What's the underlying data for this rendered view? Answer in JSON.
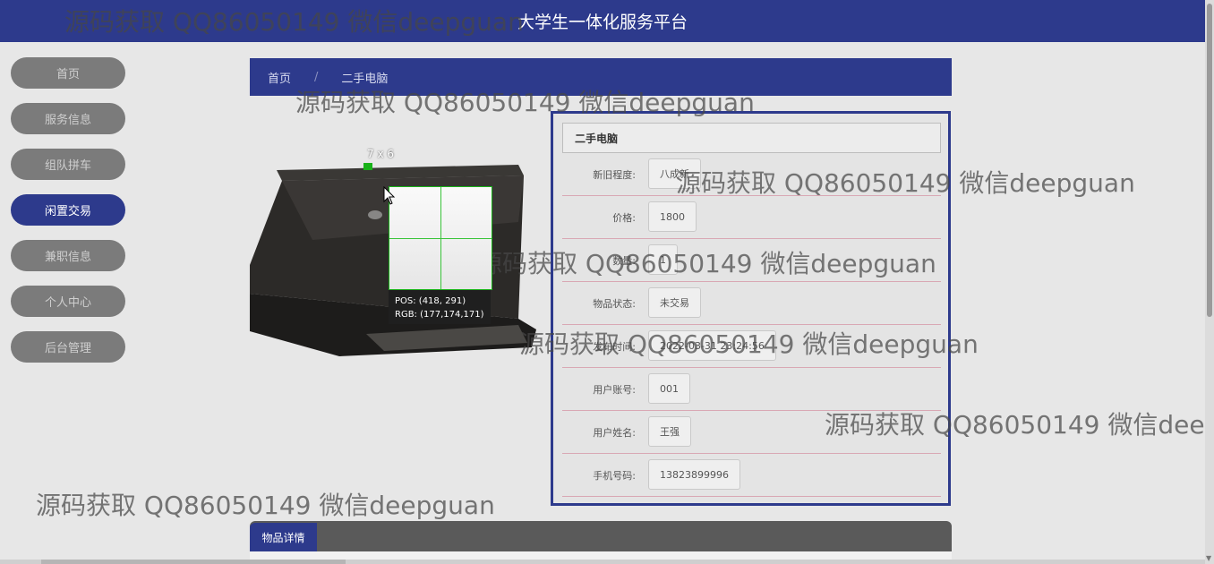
{
  "header": {
    "title": "大学生一体化服务平台"
  },
  "nav": {
    "items": [
      {
        "label": "首页"
      },
      {
        "label": "服务信息"
      },
      {
        "label": "组队拼车"
      },
      {
        "label": "闲置交易"
      },
      {
        "label": "兼职信息"
      },
      {
        "label": "个人中心"
      },
      {
        "label": "后台管理"
      }
    ],
    "active_index": 3
  },
  "breadcrumb": {
    "home": "首页",
    "separator": "/",
    "current": "二手电脑"
  },
  "detail": {
    "title": "二手电脑",
    "fields": [
      {
        "label": "新旧程度:",
        "value": "八成新"
      },
      {
        "label": "价格:",
        "value": "1800"
      },
      {
        "label": "数量:",
        "value": "1"
      },
      {
        "label": "物品状态:",
        "value": "未交易"
      },
      {
        "label": "发布时间:",
        "value": "2022-03-31 23:24:56"
      },
      {
        "label": "用户账号:",
        "value": "001"
      },
      {
        "label": "用户姓名:",
        "value": "王强"
      },
      {
        "label": "手机号码:",
        "value": "13823899996"
      }
    ]
  },
  "tabs": {
    "active_label": "物品详情"
  },
  "watermark_text": "源码获取 QQ86050149 微信deepguan",
  "overlay": {
    "size_label": "7 x 6",
    "pos_line": "POS:  (418, 291)",
    "rgb_line": "RGB:  (177,174,171)"
  },
  "colors": {
    "primary": "#2d3a8c",
    "nav_inactive": "#7b7b7b",
    "background": "#e7e7e7"
  }
}
